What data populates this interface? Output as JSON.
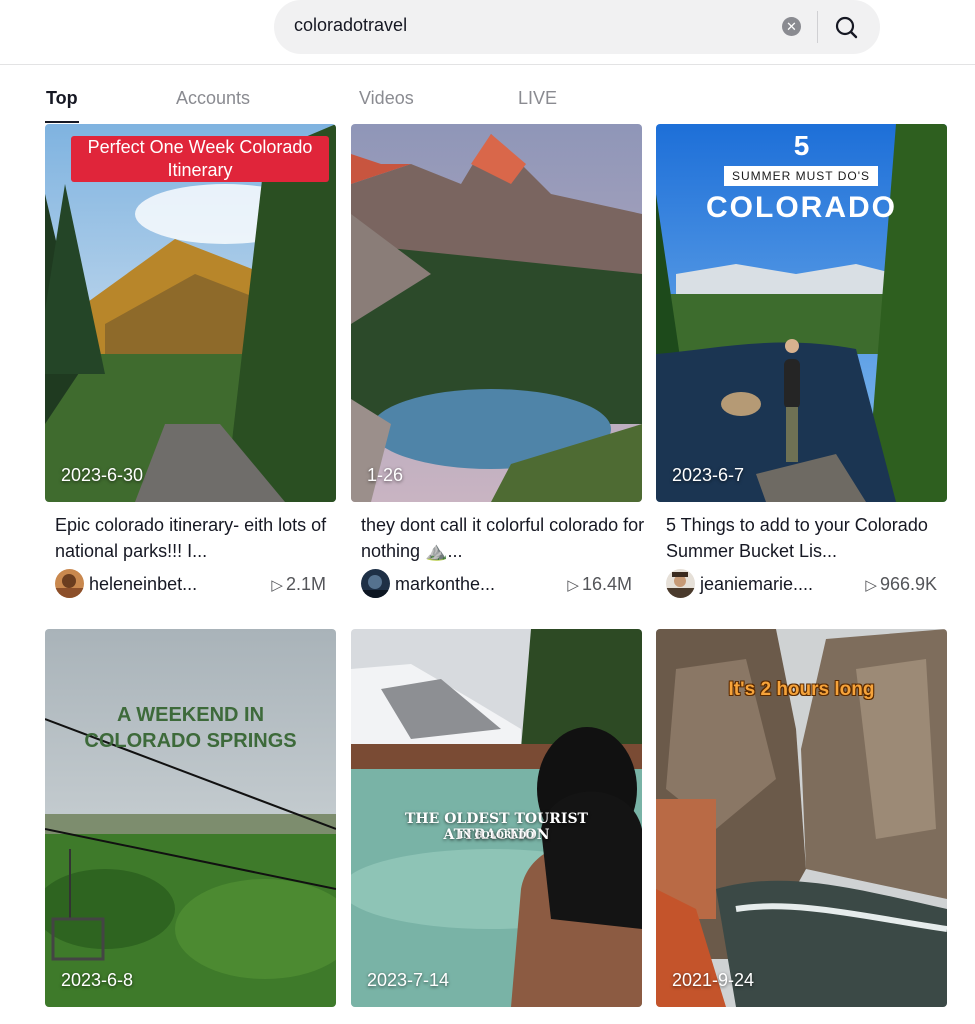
{
  "search": {
    "query": "coloradotravel",
    "clear_icon": "clear-icon",
    "search_icon": "search-icon"
  },
  "tabs": [
    {
      "label": "Top",
      "active": true
    },
    {
      "label": "Accounts",
      "active": false
    },
    {
      "label": "Videos",
      "active": false
    },
    {
      "label": "LIVE",
      "active": false
    }
  ],
  "videos": [
    {
      "date": "2023-6-30",
      "overlay": "Perfect One Week Colorado Itinerary",
      "caption": "Epic colorado itinerary- eith lots of national parks!!! I...",
      "username": "heleneinbet...",
      "views": "2.1M"
    },
    {
      "date": "1-26",
      "caption": "they dont call it colorful colorado for nothing ⛰️...",
      "username": "markonthe...",
      "views": "16.4M"
    },
    {
      "date": "2023-6-7",
      "overlay_number": "5",
      "overlay_sub": "SUMMER MUST DO'S",
      "overlay_title": "COLORADO",
      "caption": "5 Things to add to your Colorado Summer Bucket Lis...",
      "username": "jeaniemarie....",
      "views": "966.9K"
    },
    {
      "date": "2023-6-8",
      "overlay_line1": "A WEEKEND IN",
      "overlay_line2": "COLORADO SPRINGS"
    },
    {
      "date": "2023-7-14",
      "overlay_line1": "THE OLDEST TOURIST ATTRACTION",
      "overlay_line2": "IN COLORADO"
    },
    {
      "date": "2021-9-24",
      "overlay": "It's 2 hours long"
    }
  ],
  "colors": {
    "accent_red": "#e0253a",
    "tab_active": "#161823",
    "tab_inactive": "#8a8b91"
  }
}
